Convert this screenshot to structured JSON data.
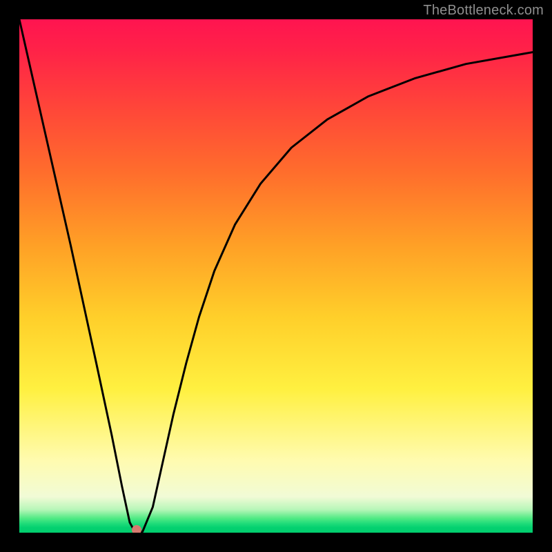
{
  "watermark": "TheBottleneck.com",
  "chart_data": {
    "type": "line",
    "title": "",
    "xlabel": "",
    "ylabel": "",
    "xlim": [
      0,
      100
    ],
    "ylim": [
      0,
      100
    ],
    "x": [
      0,
      5,
      10,
      15,
      18,
      20,
      21.5,
      22.5,
      24,
      26,
      28,
      30,
      32.5,
      35,
      38,
      42,
      47,
      53,
      60,
      68,
      77,
      87,
      100
    ],
    "values": [
      100,
      78,
      56,
      33,
      19,
      9,
      2,
      0.2,
      0.2,
      5,
      14,
      23,
      33,
      42,
      51,
      60,
      68,
      75,
      80.5,
      85,
      88.5,
      91.3,
      93.6
    ],
    "marker": {
      "x": 22.8,
      "y": 0.6,
      "color": "#d77a6f"
    },
    "gradient_stops": [
      {
        "pos": 0,
        "color": "#ff1450"
      },
      {
        "pos": 18,
        "color": "#ff4838"
      },
      {
        "pos": 44,
        "color": "#ffa026"
      },
      {
        "pos": 72,
        "color": "#fff040"
      },
      {
        "pos": 93,
        "color": "#f1fbd6"
      },
      {
        "pos": 97,
        "color": "#51ea84"
      },
      {
        "pos": 100,
        "color": "#02ce6e"
      }
    ]
  }
}
